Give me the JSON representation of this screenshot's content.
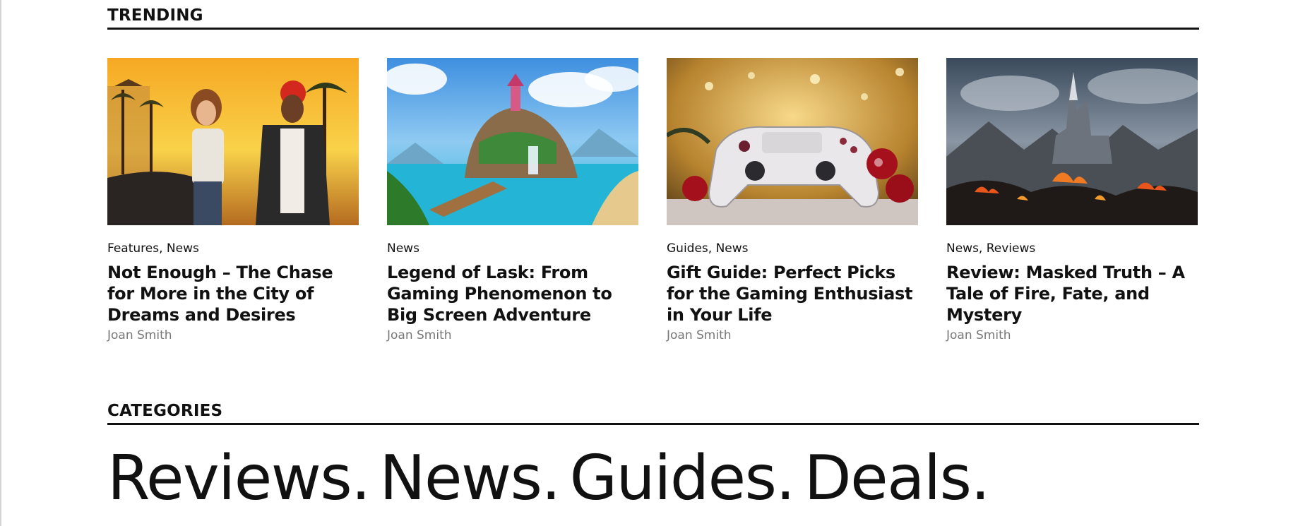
{
  "trending": {
    "heading": "TRENDING",
    "cards": [
      {
        "categories": "Features, News",
        "title": "Not Enough – The Chase for More in the City of Dreams and Desires",
        "author": "Joan Smith",
        "image_icon": "city-duo-image"
      },
      {
        "categories": "News",
        "title": "Legend of Lask: From Gaming Phenomenon to Big Screen Adventure",
        "author": "Joan Smith",
        "image_icon": "fantasy-island-image"
      },
      {
        "categories": "Guides, News",
        "title": "Gift Guide: Perfect Picks for the Gaming Enthusiast in Your Life",
        "author": "Joan Smith",
        "image_icon": "gamepad-ornaments-image"
      },
      {
        "categories": "News, Reviews",
        "title": "Review: Masked Truth – A Tale of Fire, Fate, and Mystery",
        "author": "Joan Smith",
        "image_icon": "dark-castle-fire-image"
      }
    ]
  },
  "categories": {
    "heading": "CATEGORIES",
    "items": [
      "Reviews.",
      "News.",
      "Guides.",
      "Deals."
    ]
  },
  "colors": {
    "text": "#111111",
    "muted": "#777777",
    "rule": "#111111"
  }
}
